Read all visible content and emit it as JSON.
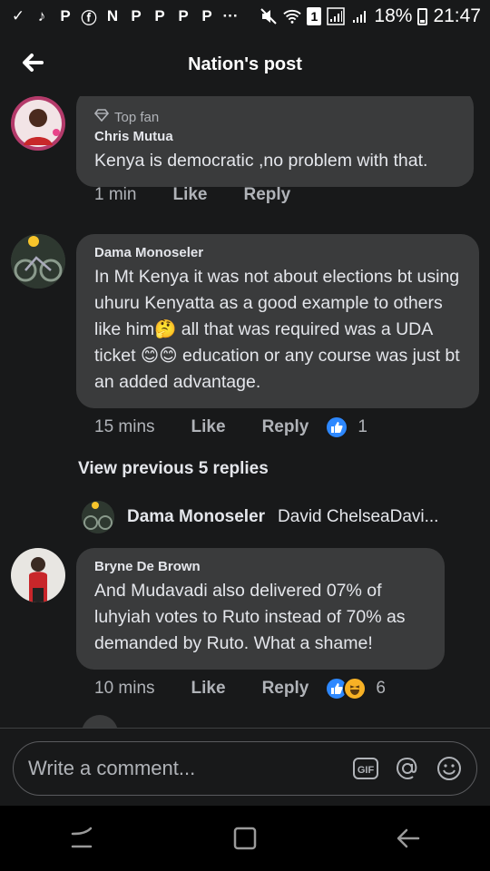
{
  "status_bar": {
    "left_icons": [
      "check-mark-icon",
      "tiktok-icon",
      "p-app-icon",
      "facebook-icon",
      "news-icon",
      "p-app-icon",
      "p-app-icon",
      "p-app-icon",
      "p-app-icon",
      "more-dots-icon"
    ],
    "battery": "18%",
    "time": "21:47",
    "sim_badge": "1"
  },
  "header": {
    "title": "Nation's post"
  },
  "comments": [
    {
      "badge": "Top fan",
      "author": "Chris Mutua",
      "text": "Kenya is democratic ,no problem with that.",
      "time": "1 min",
      "like_label": "Like",
      "reply_label": "Reply"
    },
    {
      "author": "Dama Monoseler",
      "text": "In Mt Kenya it was not about elections bt using uhuru Kenyatta as a good example to others like him🤔 all that was required was a UDA ticket 😊😊 education or any course was just bt an added advantage.",
      "time": "15 mins",
      "like_label": "Like",
      "reply_label": "Reply",
      "reaction_count": "1"
    },
    {
      "author": "Bryne De Brown",
      "text": "And Mudavadi also delivered 07% of luhyiah votes to Ruto instead of 70% as demanded by Ruto. What a shame!",
      "time": "10 mins",
      "like_label": "Like",
      "reply_label": "Reply",
      "reaction_count": "6"
    }
  ],
  "view_previous": "View previous 5 replies",
  "reply_preview": {
    "author": "Dama Monoseler",
    "text": "David ChelseaDavi..."
  },
  "composer": {
    "placeholder": "Write a comment..."
  },
  "colors": {
    "background": "#18191a",
    "bubble": "#3a3b3c",
    "like_blue": "#2d88ff",
    "haha_yellow": "#f7b125",
    "text": "#e4e6eb",
    "secondary_text": "#b0b3b8"
  }
}
